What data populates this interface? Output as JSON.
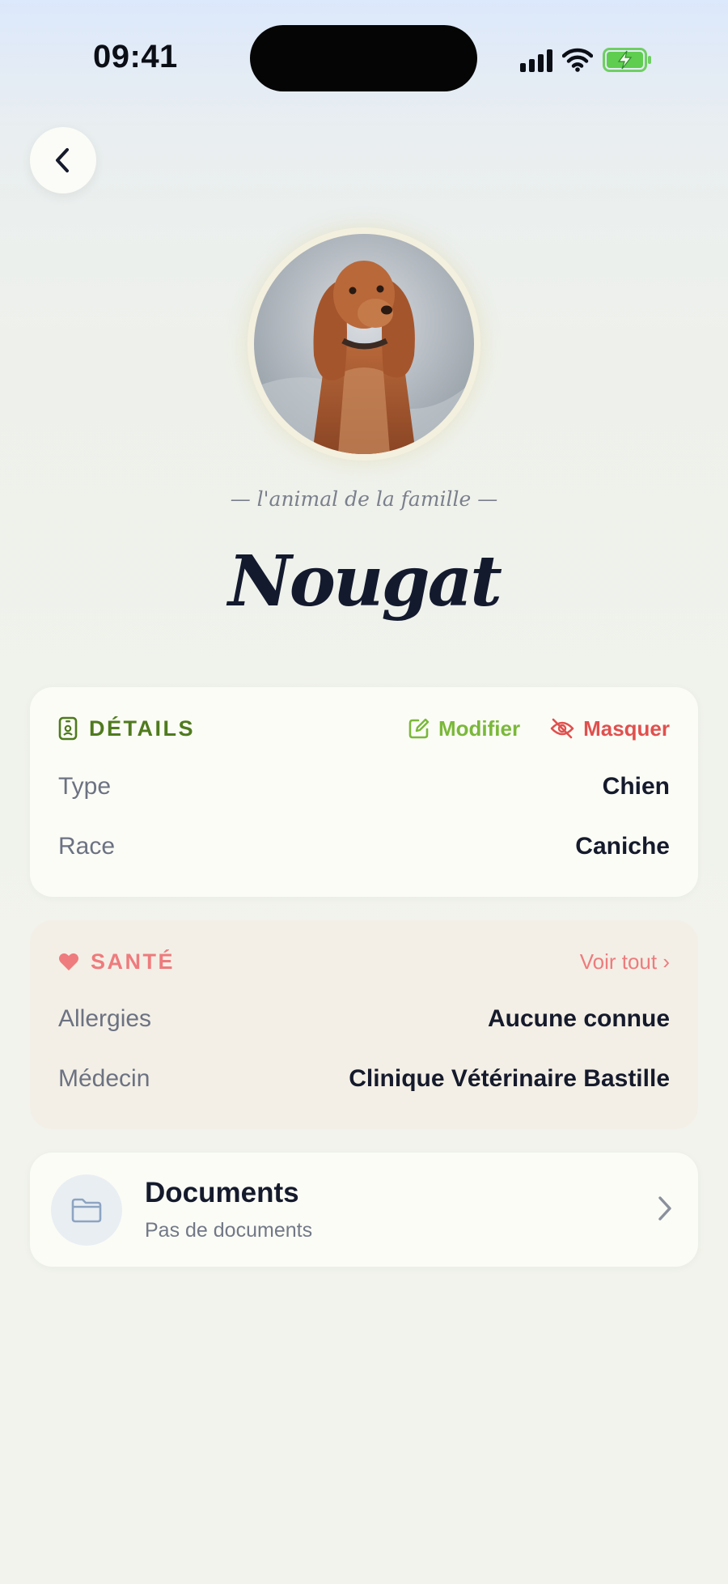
{
  "status_bar": {
    "time": "09:41",
    "icons": [
      "signal-icon",
      "wifi-icon",
      "battery-charging-icon"
    ]
  },
  "nav": {
    "back_icon": "chevron-left-icon"
  },
  "pet": {
    "tagline": "— l'animal de la famille —",
    "name": "Nougat",
    "photo": "dog-photo"
  },
  "details": {
    "title": "DÉTAILS",
    "icon": "id-badge-icon",
    "edit_label": "Modifier",
    "hide_label": "Masquer",
    "rows": [
      {
        "label": "Type",
        "value": "Chien"
      },
      {
        "label": "Race",
        "value": "Caniche"
      }
    ]
  },
  "health": {
    "title": "SANTÉ",
    "icon": "heart-icon",
    "see_all_label": "Voir tout ›",
    "rows": [
      {
        "label": "Allergies",
        "value": "Aucune connue"
      },
      {
        "label": "Médecin",
        "value": "Clinique Vétérinaire Bastille"
      }
    ]
  },
  "documents": {
    "title": "Documents",
    "subtitle": "Pas de documents",
    "icon": "folder-icon"
  },
  "colors": {
    "details_accent": "#4f7a1e",
    "edit_accent": "#7ab83a",
    "hide_accent": "#e0504e",
    "health_accent": "#ee7b7d",
    "text_primary": "#151a2c",
    "text_secondary": "#6c7282"
  }
}
